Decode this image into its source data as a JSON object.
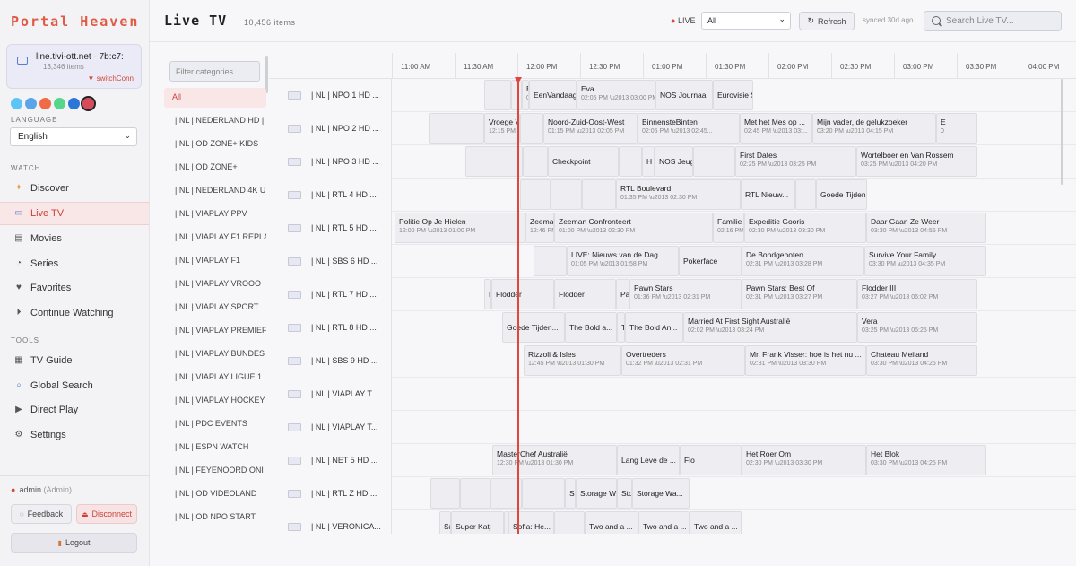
{
  "sidebar": {
    "brand": "Portal Heaven",
    "account": {
      "host": "line.tivi-ott.net · 7b:c7:",
      "items": "13,346 items",
      "status": "▼ switchConn"
    },
    "swatch_colors": [
      "#5ec4f5",
      "#5aa5e8",
      "#f06a45",
      "#56d68a",
      "#2c76d8",
      "#d94a5a"
    ],
    "language_label": "LANGUAGE",
    "language_value": "English",
    "watch_label": "WATCH",
    "watch_items": [
      "Discover",
      "Live TV",
      "Movies",
      "Series",
      "Favorites",
      "Continue Watching"
    ],
    "tools_label": "TOOLS",
    "tools_items": [
      "TV Guide",
      "Global Search",
      "Direct Play",
      "Settings"
    ],
    "user": "admin",
    "role": "(Admin)",
    "feedback": "Feedback",
    "disconnect": "Disconnect",
    "logout": "Logout"
  },
  "header": {
    "title": "Live TV",
    "count": "10,456 items",
    "live": "LIVE",
    "filter": "All",
    "refresh": "Refresh",
    "synced": "synced 30d ago",
    "search_placeholder": "Search Live TV..."
  },
  "categories": {
    "placeholder": "Filter categories...",
    "items": [
      "All",
      "| NL | NEDERLAND HD |",
      "| NL | OD ZONE+ KIDS",
      "| NL | OD ZONE+",
      "| NL | NEDERLAND 4K U",
      "| NL | VIAPLAY PPV",
      "| NL | VIAPLAY F1 REPLA",
      "| NL | VIAPLAY F1",
      "| NL | VIAPLAY VROOO",
      "| NL | VIAPLAY SPORT",
      "| NL | VIAPLAY PREMIEF",
      "| NL | VIAPLAY BUNDES",
      "| NL | VIAPLAY LIGUE 1",
      "| NL | VIAPLAY HOCKEY",
      "| NL | PDC EVENTS",
      "| NL | ESPN WATCH",
      "| NL | FEYENOORD ONI",
      "| NL | OD VIDEOLAND",
      "| NL | OD NPO START"
    ]
  },
  "epg": {
    "times": [
      "11:00 AM",
      "11:30 AM",
      "12:00 PM",
      "12:30 PM",
      "01:00 PM",
      "01:30 PM",
      "02:00 PM",
      "02:30 PM",
      "03:00 PM",
      "03:30 PM",
      "04:00 PM"
    ],
    "channels": [
      {
        "name": "| NL |  NPO 1 HD ...",
        "programs": [
          {
            "s": 240,
            "e": 270,
            "t": "",
            "d": ""
          },
          {
            "s": 270,
            "e": 282,
            "t": "",
            "d": ""
          },
          {
            "s": 282,
            "e": 290,
            "t": "E",
            "d": "0"
          },
          {
            "s": 290,
            "e": 343,
            "t": "EenVandaag",
            "d": ""
          },
          {
            "s": 343,
            "e": 431,
            "t": "Eva",
            "d": "02:05 PM \\u2013 03:00 PM"
          },
          {
            "s": 431,
            "e": 495,
            "t": "NOS Journaal",
            "d": ""
          },
          {
            "s": 495,
            "e": 540,
            "t": "Eurovisie Son...",
            "d": ""
          }
        ]
      },
      {
        "name": "| NL |  NPO 2 HD ...",
        "programs": [
          {
            "s": 178,
            "e": 240,
            "t": "",
            "d": ""
          },
          {
            "s": 240,
            "e": 280,
            "t": "Vroege Vogels",
            "d": "12:15 PM \\u2013 01:00 PM"
          },
          {
            "s": 280,
            "e": 306,
            "t": "",
            "d": ""
          },
          {
            "s": 306,
            "e": 411,
            "t": "Noord-Zuid-Oost-West",
            "d": "01:15 PM \\u2013 02:05 PM"
          },
          {
            "s": 411,
            "e": 525,
            "t": "BinnensteBinten",
            "d": "02:05 PM \\u2013 02:45..."
          },
          {
            "s": 525,
            "e": 606,
            "t": "Met het Mes op ...",
            "d": "02:45 PM \\u2013 03:..."
          },
          {
            "s": 606,
            "e": 744,
            "t": "Mijn vader, de gelukzoeker",
            "d": "03:20 PM \\u2013 04:15 PM"
          },
          {
            "s": 744,
            "e": 790,
            "t": "E",
            "d": "0"
          }
        ]
      },
      {
        "name": "| NL |  NPO 3 HD ...",
        "programs": [
          {
            "s": 219,
            "e": 283,
            "t": "",
            "d": ""
          },
          {
            "s": 283,
            "e": 311,
            "t": "",
            "d": ""
          },
          {
            "s": 311,
            "e": 390,
            "t": "Checkpoint",
            "d": ""
          },
          {
            "s": 390,
            "e": 416,
            "t": "",
            "d": ""
          },
          {
            "s": 416,
            "e": 430,
            "t": "H",
            "d": ""
          },
          {
            "s": 430,
            "e": 473,
            "t": "NOS Jeug...",
            "d": ""
          },
          {
            "s": 473,
            "e": 520,
            "t": "",
            "d": ""
          },
          {
            "s": 520,
            "e": 655,
            "t": "First Dates",
            "d": "02:25 PM \\u2013 03:25 PM"
          },
          {
            "s": 655,
            "e": 790,
            "t": "Wortelboer en Van Rossem",
            "d": "03:25 PM \\u2013 04:20 PM"
          }
        ]
      },
      {
        "name": "| NL |  RTL 4 HD ...",
        "programs": [
          {
            "s": 280,
            "e": 314,
            "t": "",
            "d": ""
          },
          {
            "s": 314,
            "e": 349,
            "t": "",
            "d": ""
          },
          {
            "s": 349,
            "e": 387,
            "t": "",
            "d": ""
          },
          {
            "s": 387,
            "e": 526,
            "t": "RTL Boulevard",
            "d": "01:35 PM \\u2013 02:30 PM"
          },
          {
            "s": 526,
            "e": 587,
            "t": "RTL Nieuw...",
            "d": ""
          },
          {
            "s": 587,
            "e": 610,
            "t": "",
            "d": ""
          },
          {
            "s": 610,
            "e": 667,
            "t": "Goede Tijden...",
            "d": ""
          }
        ]
      },
      {
        "name": "| NL |  RTL 5 HD ...",
        "programs": [
          {
            "s": 140,
            "e": 286,
            "t": "Politie Op Je Hielen",
            "d": "12:00 PM \\u2013 01:00 PM"
          },
          {
            "s": 286,
            "e": 318,
            "t": "Zeemans",
            "d": "12:46 PM"
          },
          {
            "s": 318,
            "e": 495,
            "t": "Zeeman Confronteert",
            "d": "01:00 PM \\u2013 02:30 PM"
          },
          {
            "s": 495,
            "e": 530,
            "t": "Familie",
            "d": "02:16 PM"
          },
          {
            "s": 530,
            "e": 666,
            "t": "Expeditie Gooris",
            "d": "02:30 PM \\u2013 03:30 PM"
          },
          {
            "s": 666,
            "e": 800,
            "t": "Daar Gaan Ze Weer",
            "d": "03:30 PM \\u2013 04:55 PM"
          }
        ]
      },
      {
        "name": "| NL |  SBS 6 HD ...",
        "programs": [
          {
            "s": 295,
            "e": 332,
            "t": "",
            "d": ""
          },
          {
            "s": 332,
            "e": 457,
            "t": "LIVE: Nieuws van de Dag",
            "d": "01:05 PM \\u2013 01:58 PM"
          },
          {
            "s": 457,
            "e": 527,
            "t": "Pokerface",
            "d": ""
          },
          {
            "s": 527,
            "e": 664,
            "t": "De Bondgenoten",
            "d": "02:31 PM \\u2013 03:28 PM"
          },
          {
            "s": 664,
            "e": 800,
            "t": "Survive Your Family",
            "d": "03:30 PM \\u2013 04:35 PM"
          }
        ]
      },
      {
        "name": "| NL |  RTL 7 HD ...",
        "programs": [
          {
            "s": 240,
            "e": 248,
            "t": "F",
            "d": ""
          },
          {
            "s": 248,
            "e": 318,
            "t": "Flodder",
            "d": ""
          },
          {
            "s": 318,
            "e": 387,
            "t": "Flodder",
            "d": ""
          },
          {
            "s": 387,
            "e": 402,
            "t": "Pa",
            "d": ""
          },
          {
            "s": 402,
            "e": 527,
            "t": "Pawn Stars",
            "d": "01:36 PM \\u2013 02:31 PM"
          },
          {
            "s": 527,
            "e": 656,
            "t": "Pawn Stars: Best Of",
            "d": "02:31 PM \\u2013 03:27 PM"
          },
          {
            "s": 656,
            "e": 790,
            "t": "Flodder III",
            "d": "03:27 PM \\u2013 06:02 PM"
          }
        ]
      },
      {
        "name": "| NL |  RTL 8 HD ...",
        "programs": [
          {
            "s": 260,
            "e": 330,
            "t": "Goede Tijden...",
            "d": ""
          },
          {
            "s": 330,
            "e": 388,
            "t": "The Bold a...",
            "d": ""
          },
          {
            "s": 388,
            "e": 397,
            "t": "T",
            "d": ""
          },
          {
            "s": 397,
            "e": 462,
            "t": "The Bold An...",
            "d": ""
          },
          {
            "s": 462,
            "e": 656,
            "t": "Married At First Sight Australië",
            "d": "02:02 PM \\u2013 03:24 PM"
          },
          {
            "s": 656,
            "e": 790,
            "t": "Vera",
            "d": "03:25 PM \\u2013 05:25 PM"
          }
        ]
      },
      {
        "name": "| NL |  SBS 9 HD ...",
        "programs": [
          {
            "s": 284,
            "e": 393,
            "t": "Rizzoli & Isles",
            "d": "12:45 PM \\u2013 01:30 PM"
          },
          {
            "s": 393,
            "e": 531,
            "t": "Overtreders",
            "d": "01:32 PM \\u2013 02:31 PM"
          },
          {
            "s": 531,
            "e": 666,
            "t": "Mr. Frank Visser: hoe is het nu ...",
            "d": "02:31 PM \\u2013 03:30 PM"
          },
          {
            "s": 666,
            "e": 790,
            "t": "Chateau Meiland",
            "d": "03:30 PM \\u2013 04:25 PM"
          }
        ]
      },
      {
        "name": "| NL |  VIAPLAY T...",
        "programs": []
      },
      {
        "name": "| NL |  VIAPLAY T...",
        "programs": []
      },
      {
        "name": "| NL |  NET 5 HD ...",
        "programs": [
          {
            "s": 249,
            "e": 388,
            "t": "MasterChef Australië",
            "d": "12:30 PM \\u2013 01:30 PM"
          },
          {
            "s": 388,
            "e": 458,
            "t": "Lang Leve de ...",
            "d": ""
          },
          {
            "s": 458,
            "e": 527,
            "t": "Flo",
            "d": ""
          },
          {
            "s": 527,
            "e": 666,
            "t": "Het Roer Om",
            "d": "02:30 PM \\u2013 03:30 PM"
          },
          {
            "s": 666,
            "e": 800,
            "t": "Het Blok",
            "d": "03:30 PM \\u2013 04:25 PM"
          }
        ]
      },
      {
        "name": "| NL |  RTL Z HD ...",
        "programs": [
          {
            "s": 180,
            "e": 213,
            "t": "",
            "d": ""
          },
          {
            "s": 213,
            "e": 247,
            "t": "",
            "d": ""
          },
          {
            "s": 247,
            "e": 282,
            "t": "",
            "d": ""
          },
          {
            "s": 282,
            "e": 330,
            "t": "",
            "d": ""
          },
          {
            "s": 330,
            "e": 342,
            "t": "St",
            "d": ""
          },
          {
            "s": 342,
            "e": 388,
            "t": "Storage W",
            "d": ""
          },
          {
            "s": 388,
            "e": 405,
            "t": "Sto",
            "d": ""
          },
          {
            "s": 405,
            "e": 469,
            "t": "Storage Wa...",
            "d": ""
          }
        ]
      },
      {
        "name": "| NL |  VERONICA...",
        "programs": [
          {
            "s": 190,
            "e": 203,
            "t": "Sı",
            "d": ""
          },
          {
            "s": 203,
            "e": 262,
            "t": "Super Katj",
            "d": ""
          },
          {
            "s": 262,
            "e": 267,
            "t": "Sof",
            "d": ""
          },
          {
            "s": 267,
            "e": 318,
            "t": "Sofia: He...",
            "d": ""
          },
          {
            "s": 318,
            "e": 352,
            "t": "",
            "d": ""
          },
          {
            "s": 352,
            "e": 412,
            "t": "Two and a ...",
            "d": ""
          },
          {
            "s": 412,
            "e": 469,
            "t": "Two and a ...",
            "d": ""
          },
          {
            "s": 469,
            "e": 527,
            "t": "Two and a ...",
            "d": ""
          }
        ]
      }
    ]
  }
}
